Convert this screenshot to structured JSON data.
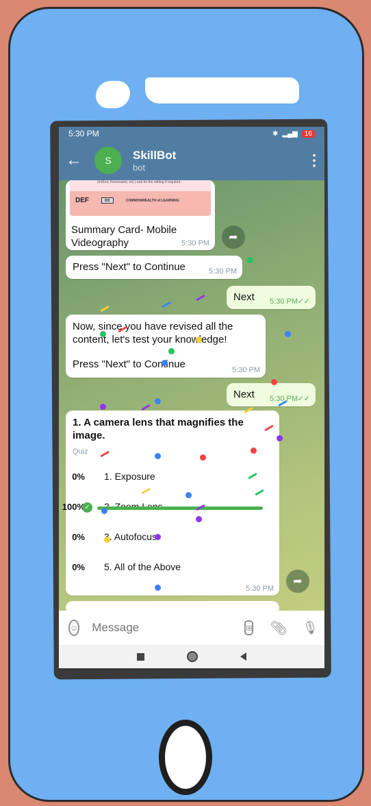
{
  "status_bar": {
    "time": "5:30 PM",
    "battery": "16"
  },
  "header": {
    "title": "SkillBot",
    "subtitle": "bot",
    "avatar_letter": "S"
  },
  "summary_card": {
    "top_text": "(InShot, Kinemaster, etc.) and do the editing if required.",
    "logo_left": "DEF",
    "logo_badge": "cc",
    "logo_right": "COMMONWEALTH of LEARNING",
    "caption": "Summary Card- Mobile Videography",
    "time": "5:30 PM"
  },
  "messages": [
    {
      "id": "m1",
      "dir": "in",
      "text": "Press \"Next\" to Continue",
      "time": "5:30 PM"
    },
    {
      "id": "m2",
      "dir": "out",
      "text": "Next",
      "time": "5:30 PM"
    },
    {
      "id": "m3",
      "dir": "in",
      "line1": "Now, since you have revised all the content, let's test your knowledge!",
      "line2": "Press \"Next\" to Continue",
      "time": "5:30 PM"
    },
    {
      "id": "m4",
      "dir": "out",
      "text": "Next",
      "time": "5:30 PM"
    }
  ],
  "quiz": {
    "question": "1. A camera lens that magnifies the image.",
    "type": "Quiz",
    "options": [
      {
        "percent": "0%",
        "label": "1. Exposure"
      },
      {
        "percent": "100%",
        "label": "2. Zoom Lens",
        "correct": true,
        "fill": 1.0
      },
      {
        "percent": "0%",
        "label": "3. Autofocus"
      },
      {
        "percent": "0%",
        "label": "5. All of the Above"
      }
    ],
    "time": "5:30 PM"
  },
  "composer": {
    "placeholder": "Message"
  },
  "colors": {
    "header": "#517da2",
    "bubble_out": "#effdde",
    "accent_green": "#4caf50",
    "frame": "#6eb0f2"
  }
}
